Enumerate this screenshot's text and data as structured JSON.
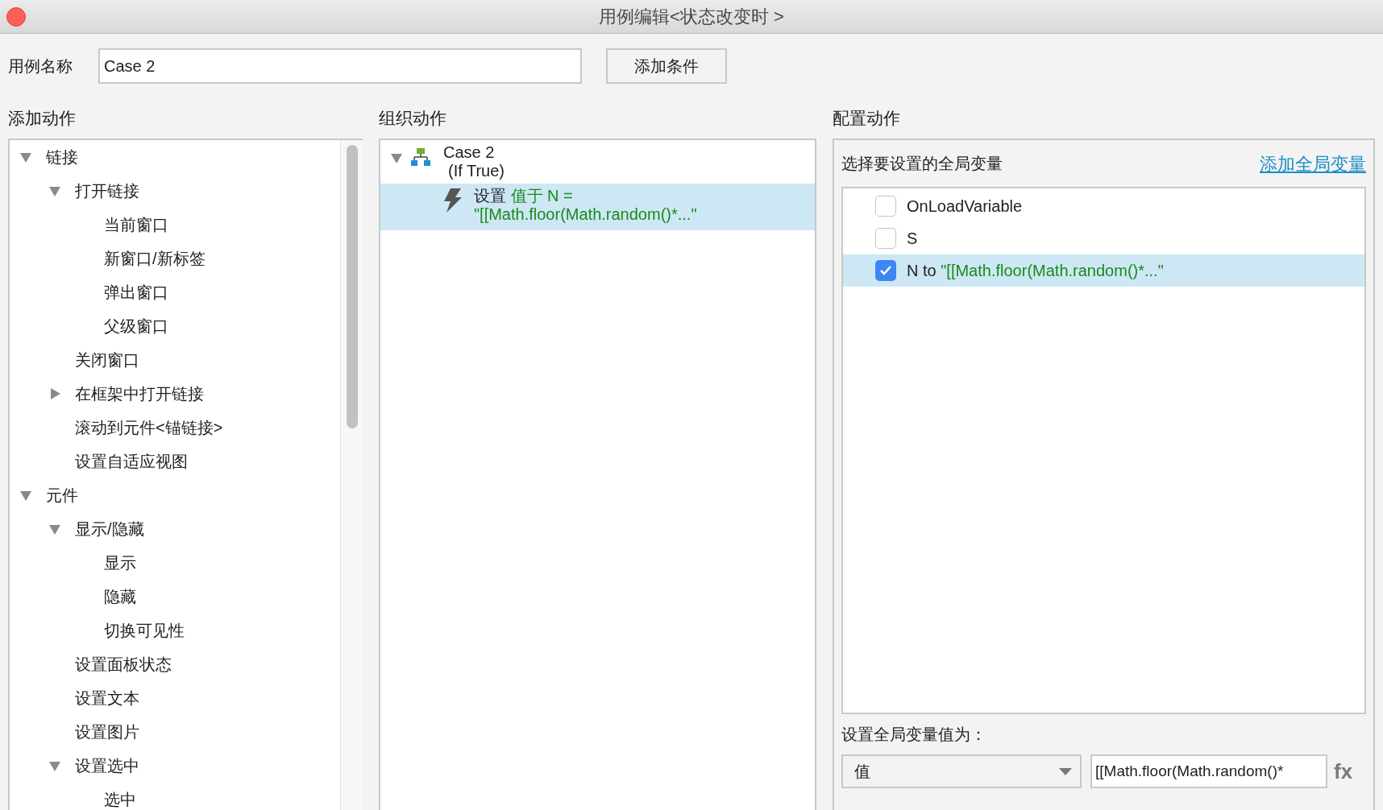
{
  "window": {
    "title": "用例编辑<状态改变时 >"
  },
  "case_name": {
    "label": "用例名称",
    "value": "Case 2"
  },
  "add_condition_button": "添加条件",
  "add_actions": {
    "heading": "添加动作",
    "tree": [
      {
        "label": "链接",
        "expanded": true,
        "children": [
          {
            "label": "打开链接",
            "expanded": true,
            "children": [
              {
                "label": "当前窗口"
              },
              {
                "label": "新窗口/新标签"
              },
              {
                "label": "弹出窗口"
              },
              {
                "label": "父级窗口"
              }
            ]
          },
          {
            "label": "关闭窗口"
          },
          {
            "label": "在框架中打开链接",
            "expanded": false
          },
          {
            "label": "滚动到元件<锚链接>"
          },
          {
            "label": "设置自适应视图"
          }
        ]
      },
      {
        "label": "元件",
        "expanded": true,
        "children": [
          {
            "label": "显示/隐藏",
            "expanded": true,
            "children": [
              {
                "label": "显示"
              },
              {
                "label": "隐藏"
              },
              {
                "label": "切换可见性"
              }
            ]
          },
          {
            "label": "设置面板状态"
          },
          {
            "label": "设置文本"
          },
          {
            "label": "设置图片"
          },
          {
            "label": "设置选中",
            "expanded": true,
            "children": [
              {
                "label": "选中"
              }
            ]
          }
        ]
      }
    ]
  },
  "organize_actions": {
    "heading": "组织动作",
    "case": {
      "title": "Case 2",
      "condition": "(If True)",
      "expanded": true
    },
    "actions": [
      {
        "verb": "设置",
        "detail": "值于 N =",
        "value": "\"[[Math.floor(Math.random()*...\"",
        "selected": true
      }
    ]
  },
  "configure_action": {
    "heading": "配置动作",
    "prompt": "选择要设置的全局变量",
    "add_link": "添加全局变量",
    "variables": [
      {
        "name": "OnLoadVariable",
        "checked": false,
        "selected": false
      },
      {
        "name": "S",
        "checked": false,
        "selected": false
      },
      {
        "name": "N to",
        "value": "\"[[Math.floor(Math.random()*...\"",
        "checked": true,
        "selected": true
      }
    ],
    "value_label": "设置全局变量值为：",
    "value_type": "值",
    "value_field": "[[Math.floor(Math.random()*",
    "fx_button": "fx"
  }
}
